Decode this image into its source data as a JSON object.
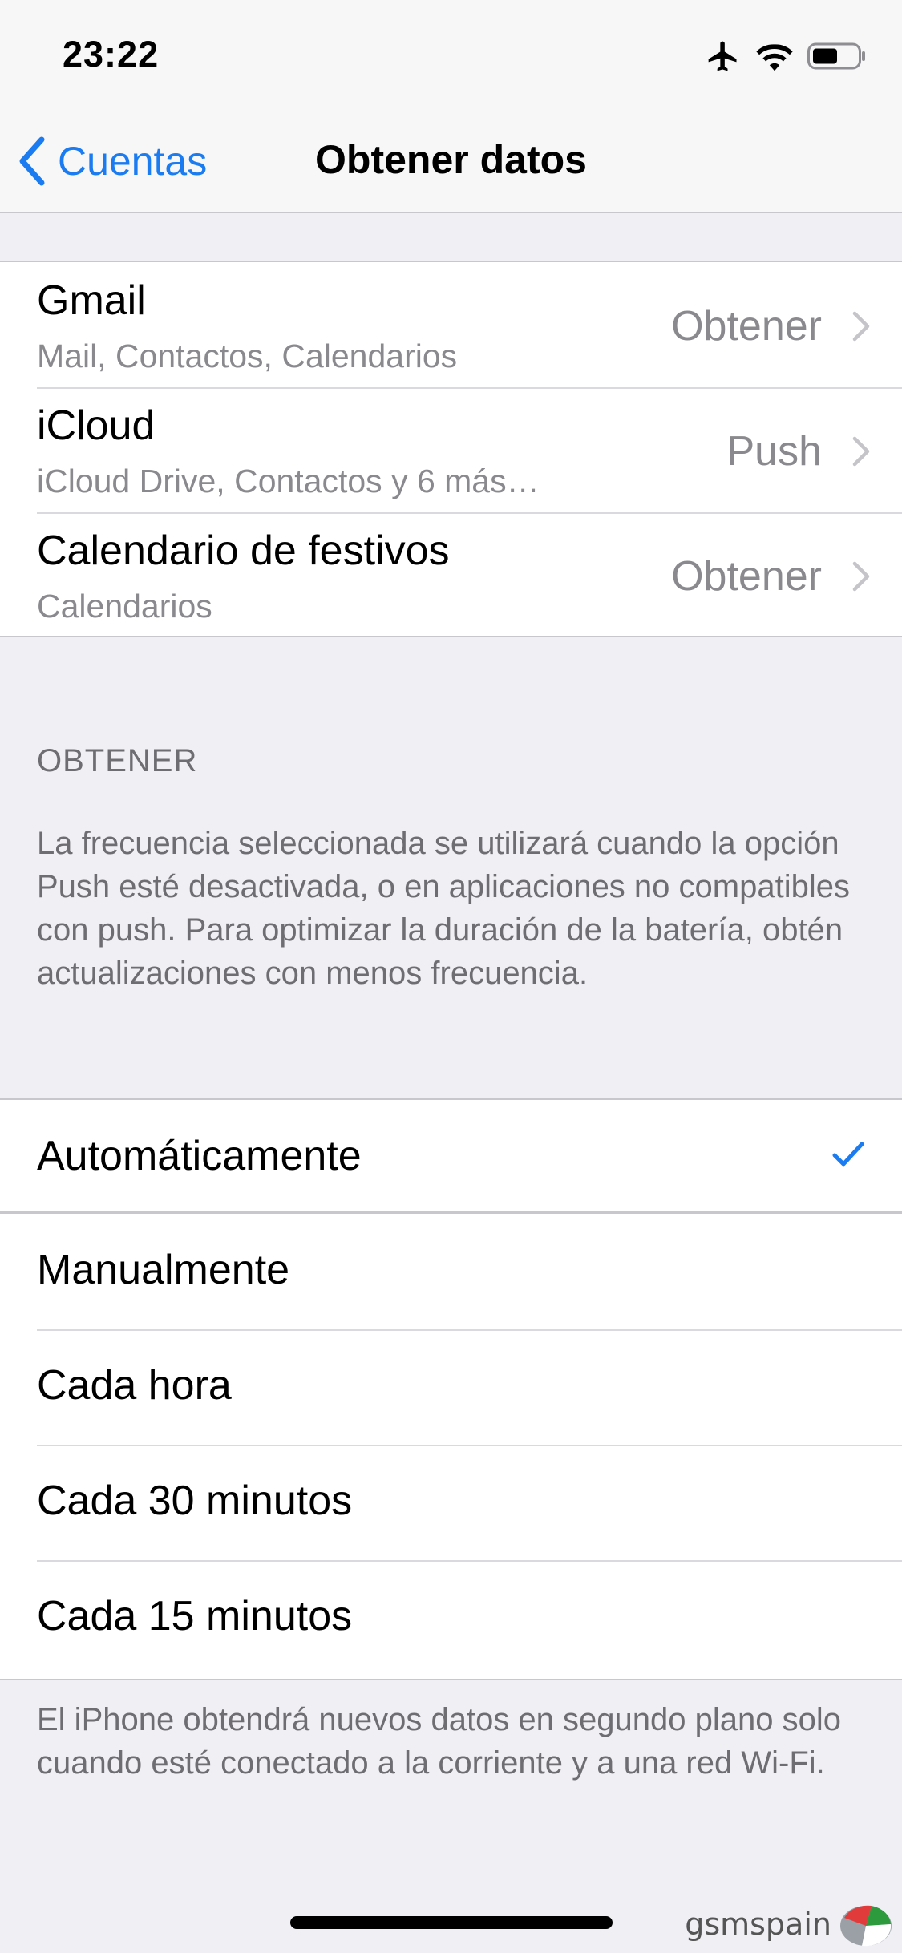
{
  "status_bar": {
    "time": "23:22",
    "icons": [
      "airplane-icon",
      "wifi-icon",
      "battery-icon"
    ]
  },
  "nav": {
    "back_label": "Cuentas",
    "title": "Obtener datos"
  },
  "accounts": [
    {
      "name": "Gmail",
      "subtitle": "Mail, Contactos, Calendarios",
      "value": "Obtener"
    },
    {
      "name": "iCloud",
      "subtitle": "iCloud Drive, Contactos y 6 más…",
      "value": "Push"
    },
    {
      "name": "Calendario de festivos",
      "subtitle": "Calendarios",
      "value": "Obtener"
    }
  ],
  "fetch_section": {
    "header": "OBTENER",
    "description": "La frecuencia seleccionada se utilizará cuando la opción Push esté desactivada, o en aplicaciones no compatibles con push. Para optimizar la duración de la batería, obtén actualizaciones con menos frecuencia."
  },
  "options": [
    {
      "label": "Automáticamente",
      "selected": true
    },
    {
      "label": "Manualmente",
      "selected": false
    },
    {
      "label": "Cada hora",
      "selected": false
    },
    {
      "label": "Cada 30 minutos",
      "selected": false
    },
    {
      "label": "Cada 15 minutos",
      "selected": false
    }
  ],
  "footer_note": "El iPhone obtendrá nuevos datos en segundo plano solo cuando esté conectado a la corriente y a una red Wi-Fi.",
  "watermark": "gsmspain",
  "colors": {
    "accent": "#1a7cf0",
    "secondary_text": "#8a8a8e",
    "background": "#efeff4"
  }
}
